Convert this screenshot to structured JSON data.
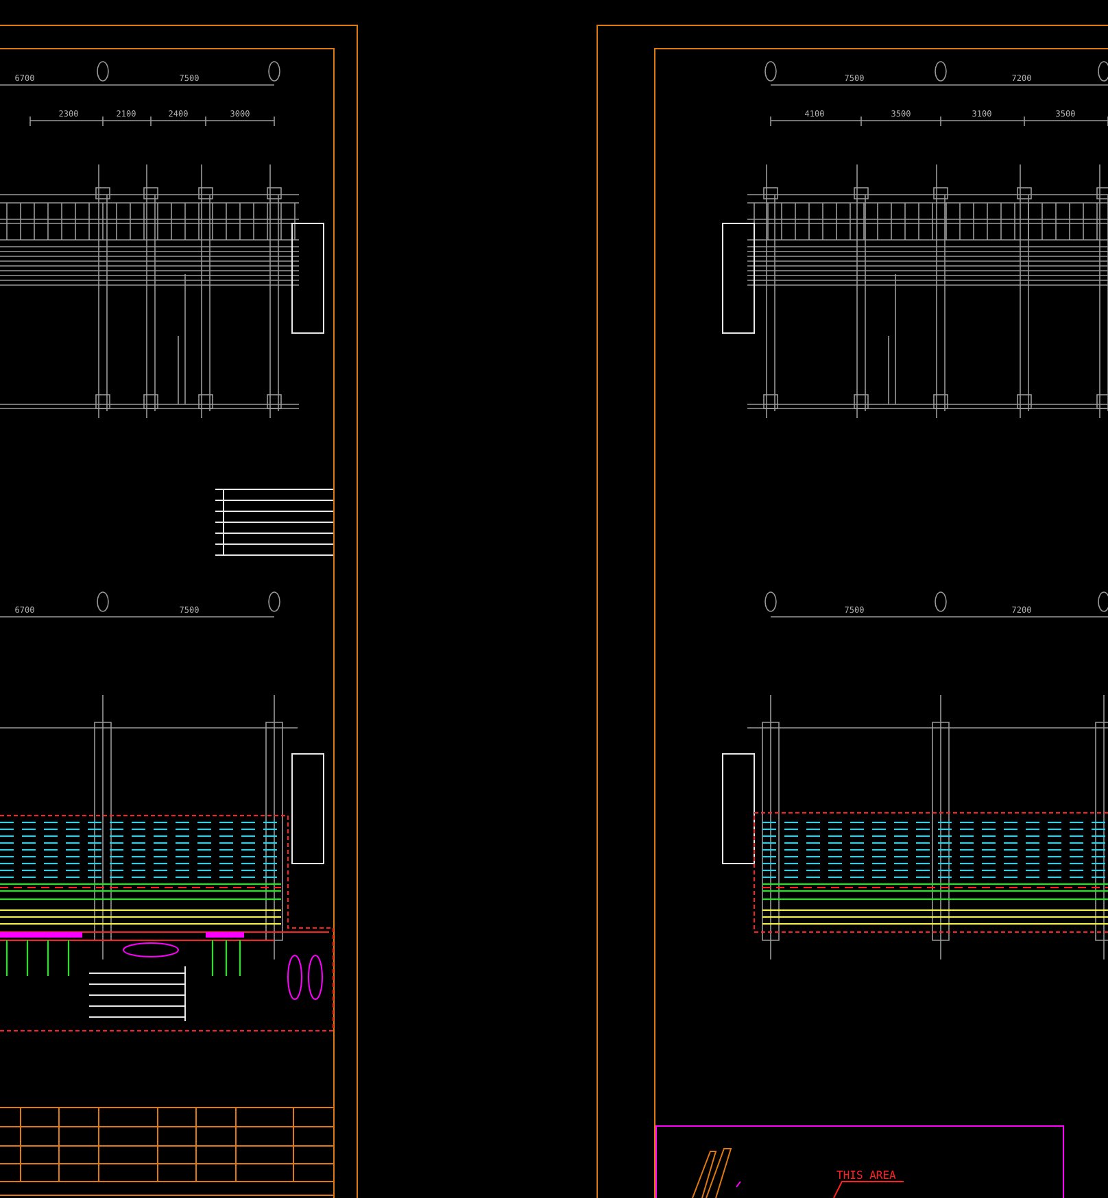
{
  "left_sheet": {
    "plan_1": {
      "axis_dims": [
        "6700",
        "7500"
      ],
      "bay_dims": [
        "2300",
        "2100",
        "2400",
        "3000"
      ]
    },
    "plan_2": {
      "axis_dims": [
        "6700",
        "7500"
      ]
    }
  },
  "right_sheet": {
    "plan_1": {
      "axis_dims": [
        "7500",
        "7200"
      ],
      "bay_dims": [
        "4100",
        "3500",
        "3100",
        "3500"
      ]
    },
    "plan_2": {
      "axis_dims": [
        "7500",
        "7200"
      ]
    },
    "callout": {
      "label": "THIS AREA"
    }
  }
}
